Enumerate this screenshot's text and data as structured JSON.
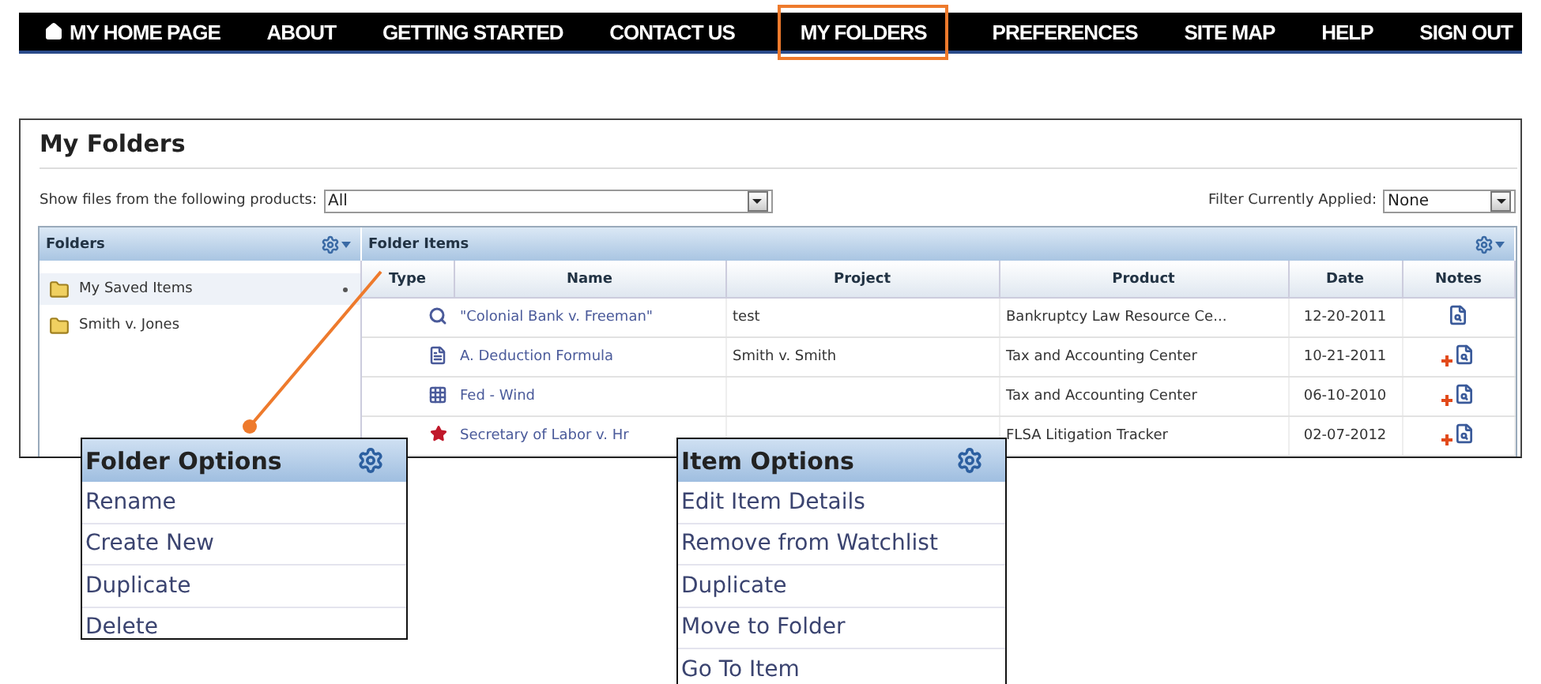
{
  "nav": [
    {
      "label": "MY HOME PAGE",
      "kind": "home",
      "selected": false
    },
    {
      "label": "ABOUT",
      "selected": false
    },
    {
      "label": "GETTING STARTED",
      "selected": false
    },
    {
      "label": "CONTACT US",
      "selected": false
    },
    {
      "label": "MY FOLDERS",
      "selected": true
    },
    {
      "label": "PREFERENCES",
      "selected": false
    },
    {
      "label": "SITE MAP",
      "selected": false
    },
    {
      "label": "HELP",
      "selected": false
    },
    {
      "label": "SIGN OUT",
      "selected": false
    }
  ],
  "page": {
    "title": "My Folders",
    "product_filter": {
      "label": "Show files from the following products:",
      "value": "All"
    },
    "applied_filter": {
      "label": "Filter Currently Applied:",
      "value": "None"
    },
    "folders": {
      "title": "Folders",
      "items": [
        {
          "label": "My Saved Items",
          "selected": true
        },
        {
          "label": "Smith v. Jones",
          "selected": false
        }
      ]
    },
    "items": {
      "title": "Folder Items",
      "columns": [
        "Type",
        "Name",
        "Project",
        "Product",
        "Date",
        "Notes"
      ],
      "rows": [
        {
          "kind": "search",
          "name": "\"Colonial Bank v. Freeman\"",
          "project": "test",
          "product": "Bankruptcy Law Resource Ce...",
          "date": "12-20-2011",
          "note_added": false
        },
        {
          "kind": "note",
          "name": "A. Deduction Formula",
          "project": "Smith v. Smith",
          "product": "Tax and Accounting Center",
          "date": "10-21-2011",
          "note_added": true
        },
        {
          "kind": "grid",
          "name": "Fed - Wind",
          "project": "",
          "product": "Tax and Accounting Center",
          "date": "06-10-2010",
          "note_added": true
        },
        {
          "kind": "star",
          "name": "Secretary of Labor v. Hr",
          "project": "",
          "product": "FLSA Litigation Tracker",
          "date": "02-07-2012",
          "note_added": true
        }
      ]
    }
  },
  "folder_options": {
    "title": "Folder Options",
    "items": [
      "Rename",
      "Create New",
      "Duplicate",
      "Delete"
    ]
  },
  "item_options": {
    "title": "Item Options",
    "items": [
      "Edit Item Details",
      "Remove from Watchlist",
      "Duplicate",
      "Move to Folder",
      "Go To Item"
    ]
  }
}
